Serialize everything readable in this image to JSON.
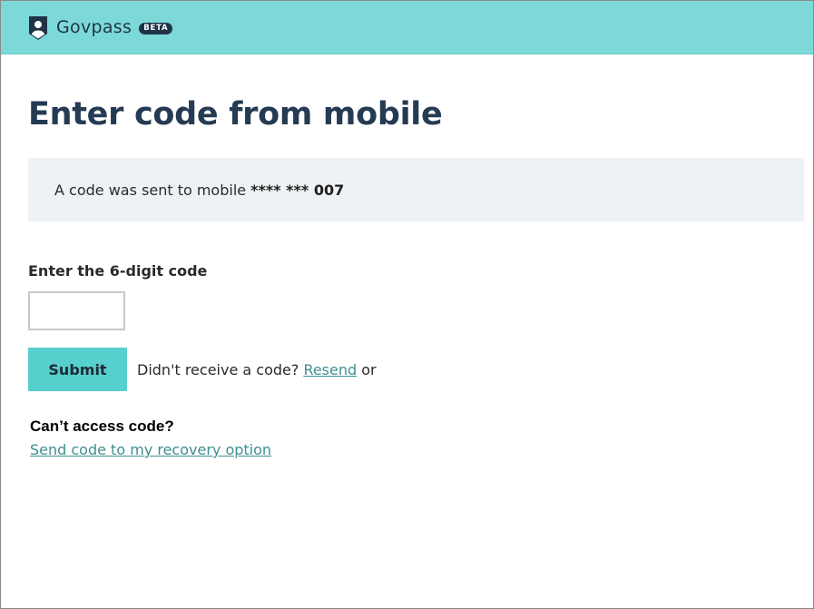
{
  "header": {
    "brand": "Govpass",
    "badge": "BETA",
    "logo_icon": "shield-user-icon"
  },
  "main": {
    "title": "Enter code from mobile",
    "notice_text": "A code was sent to mobile",
    "masked_number": "**** *** 007",
    "field_label": "Enter the 6-digit code",
    "code_value": "",
    "submit_label": "Submit",
    "resend_prompt": "Didn't receive a code?",
    "resend_link": "Resend",
    "resend_suffix": "or",
    "cant_access": "Can’t access code?",
    "recovery_link": "Send code to my recovery option"
  },
  "colors": {
    "header_bg": "#7cd9d8",
    "title": "#243b53",
    "notice_bg": "#eff2f4",
    "button_bg": "#57cfcd",
    "link": "#3e8f8e"
  }
}
